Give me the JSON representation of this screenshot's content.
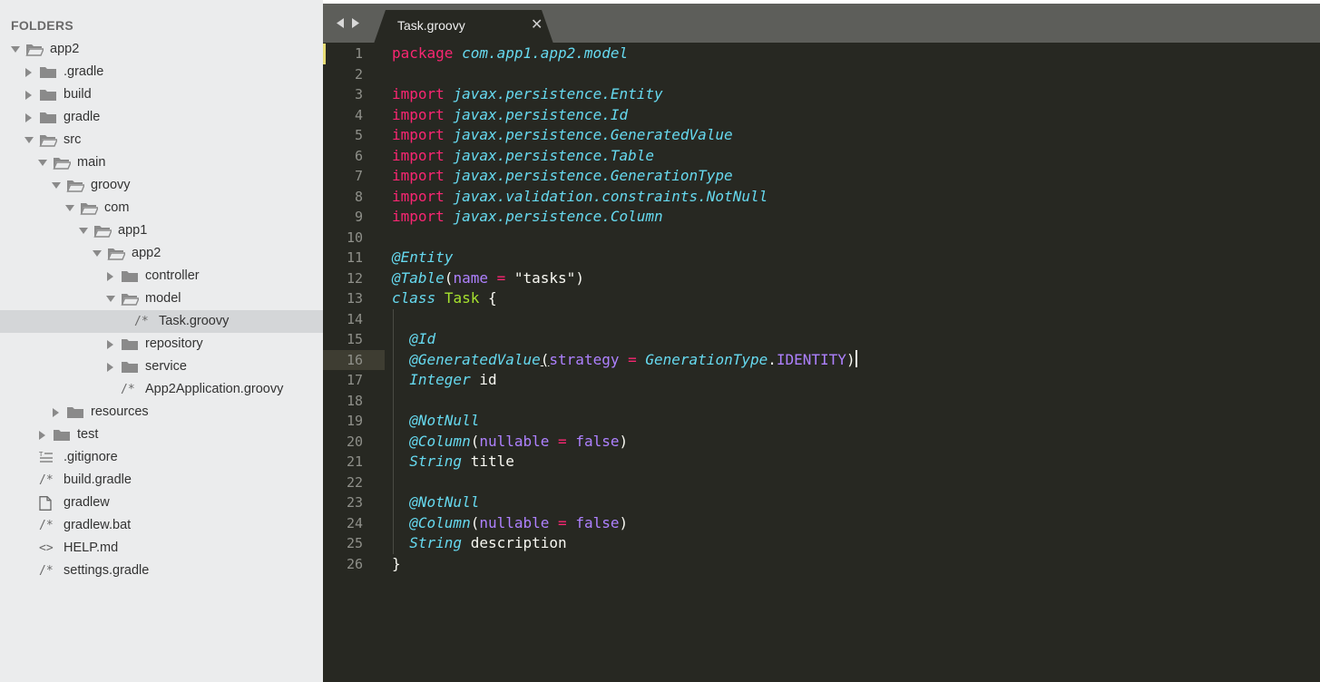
{
  "sidebar": {
    "header": "FOLDERS",
    "tree": [
      {
        "label": "app2",
        "depth": 0,
        "type": "folder",
        "state": "open"
      },
      {
        "label": ".gradle",
        "depth": 1,
        "type": "folder",
        "state": "closed"
      },
      {
        "label": "build",
        "depth": 1,
        "type": "folder",
        "state": "closed"
      },
      {
        "label": "gradle",
        "depth": 1,
        "type": "folder",
        "state": "closed"
      },
      {
        "label": "src",
        "depth": 1,
        "type": "folder",
        "state": "open"
      },
      {
        "label": "main",
        "depth": 2,
        "type": "folder",
        "state": "open"
      },
      {
        "label": "groovy",
        "depth": 3,
        "type": "folder",
        "state": "open"
      },
      {
        "label": "com",
        "depth": 4,
        "type": "folder",
        "state": "open"
      },
      {
        "label": "app1",
        "depth": 5,
        "type": "folder",
        "state": "open"
      },
      {
        "label": "app2",
        "depth": 6,
        "type": "folder",
        "state": "open"
      },
      {
        "label": "controller",
        "depth": 7,
        "type": "folder",
        "state": "closed"
      },
      {
        "label": "model",
        "depth": 7,
        "type": "folder",
        "state": "open"
      },
      {
        "label": "Task.groovy",
        "depth": 8,
        "type": "file",
        "icon": "comment-file-icon",
        "glyph": "/*",
        "selected": true
      },
      {
        "label": "repository",
        "depth": 7,
        "type": "folder",
        "state": "closed"
      },
      {
        "label": "service",
        "depth": 7,
        "type": "folder",
        "state": "closed"
      },
      {
        "label": "App2Application.groovy",
        "depth": 7,
        "type": "file",
        "icon": "comment-file-icon",
        "glyph": "/*"
      },
      {
        "label": "resources",
        "depth": 3,
        "type": "folder",
        "state": "closed"
      },
      {
        "label": "test",
        "depth": 2,
        "type": "folder",
        "state": "closed"
      },
      {
        "label": ".gitignore",
        "depth": 1,
        "type": "file",
        "icon": "text-lines-file-icon",
        "glyph": "≡"
      },
      {
        "label": "build.gradle",
        "depth": 1,
        "type": "file",
        "icon": "comment-file-icon",
        "glyph": "/*"
      },
      {
        "label": "gradlew",
        "depth": 1,
        "type": "file",
        "icon": "blank-file-icon",
        "glyph": ""
      },
      {
        "label": "gradlew.bat",
        "depth": 1,
        "type": "file",
        "icon": "comment-file-icon",
        "glyph": "/*"
      },
      {
        "label": "HELP.md",
        "depth": 1,
        "type": "file",
        "icon": "markup-file-icon",
        "glyph": "<>"
      },
      {
        "label": "settings.gradle",
        "depth": 1,
        "type": "file",
        "icon": "comment-file-icon",
        "glyph": "/*"
      }
    ]
  },
  "tabbar": {
    "active_tab": {
      "title": "Task.groovy",
      "close_glyph": "✕"
    },
    "nav_icons": [
      "chevron-left-icon",
      "chevron-right-icon"
    ]
  },
  "editor": {
    "active_line": 16,
    "modified_line": 1,
    "lines": [
      [
        [
          "package ",
          "pink"
        ],
        [
          "com.app1.app2.model",
          "blueit"
        ]
      ],
      [],
      [
        [
          "import ",
          "pink"
        ],
        [
          "javax.persistence.Entity",
          "blueit"
        ]
      ],
      [
        [
          "import ",
          "pink"
        ],
        [
          "javax.persistence.Id",
          "blueit"
        ]
      ],
      [
        [
          "import ",
          "pink"
        ],
        [
          "javax.persistence.GeneratedValue",
          "blueit"
        ]
      ],
      [
        [
          "import ",
          "pink"
        ],
        [
          "javax.persistence.Table",
          "blueit"
        ]
      ],
      [
        [
          "import ",
          "pink"
        ],
        [
          "javax.persistence.GenerationType",
          "blueit"
        ]
      ],
      [
        [
          "import ",
          "pink"
        ],
        [
          "javax.validation.constraints.NotNull",
          "blueit"
        ]
      ],
      [
        [
          "import ",
          "pink"
        ],
        [
          "javax.persistence.Column",
          "blueit"
        ]
      ],
      [],
      [
        [
          "@Entity",
          "blueit"
        ]
      ],
      [
        [
          "@Table",
          "blueit"
        ],
        [
          "(",
          "plain"
        ],
        [
          "name",
          "purple"
        ],
        [
          " = ",
          "pink"
        ],
        [
          "\"tasks\"",
          "plain"
        ],
        [
          ")",
          "plain"
        ]
      ],
      [
        [
          "class",
          "blueit"
        ],
        [
          " ",
          "plain"
        ],
        [
          "Task",
          "green"
        ],
        [
          " {",
          "plain"
        ]
      ],
      [],
      [
        [
          "  ",
          "plain"
        ],
        [
          "@Id",
          "blueit"
        ]
      ],
      [
        [
          "  ",
          "plain"
        ],
        [
          "@GeneratedValue",
          "blueit"
        ],
        [
          "(",
          "underline"
        ],
        [
          "strategy",
          "purple"
        ],
        [
          " = ",
          "pink"
        ],
        [
          "GenerationType",
          "blueit"
        ],
        [
          ".",
          "plain"
        ],
        [
          "IDENTITY",
          "purple"
        ],
        [
          ")",
          "plain"
        ],
        [
          "|",
          "cursor"
        ]
      ],
      [
        [
          "  ",
          "plain"
        ],
        [
          "Integer",
          "blueit"
        ],
        [
          " id",
          "plain"
        ]
      ],
      [],
      [
        [
          "  ",
          "plain"
        ],
        [
          "@NotNull",
          "blueit"
        ]
      ],
      [
        [
          "  ",
          "plain"
        ],
        [
          "@Column",
          "blueit"
        ],
        [
          "(",
          "plain"
        ],
        [
          "nullable",
          "purple"
        ],
        [
          " = ",
          "pink"
        ],
        [
          "false",
          "purple"
        ],
        [
          ")",
          "plain"
        ]
      ],
      [
        [
          "  ",
          "plain"
        ],
        [
          "String",
          "blueit"
        ],
        [
          " title",
          "plain"
        ]
      ],
      [],
      [
        [
          "  ",
          "plain"
        ],
        [
          "@NotNull",
          "blueit"
        ]
      ],
      [
        [
          "  ",
          "plain"
        ],
        [
          "@Column",
          "blueit"
        ],
        [
          "(",
          "plain"
        ],
        [
          "nullable",
          "purple"
        ],
        [
          " = ",
          "pink"
        ],
        [
          "false",
          "purple"
        ],
        [
          ")",
          "plain"
        ]
      ],
      [
        [
          "  ",
          "plain"
        ],
        [
          "String",
          "blueit"
        ],
        [
          " description",
          "plain"
        ]
      ],
      [
        [
          "}",
          "plain"
        ]
      ]
    ]
  },
  "colors": {
    "sidebar_bg": "#ebeced",
    "editor_bg": "#272822",
    "keyword": "#f92672",
    "type": "#66d9ef",
    "classname": "#a6e22e",
    "constant": "#ae81ff"
  }
}
